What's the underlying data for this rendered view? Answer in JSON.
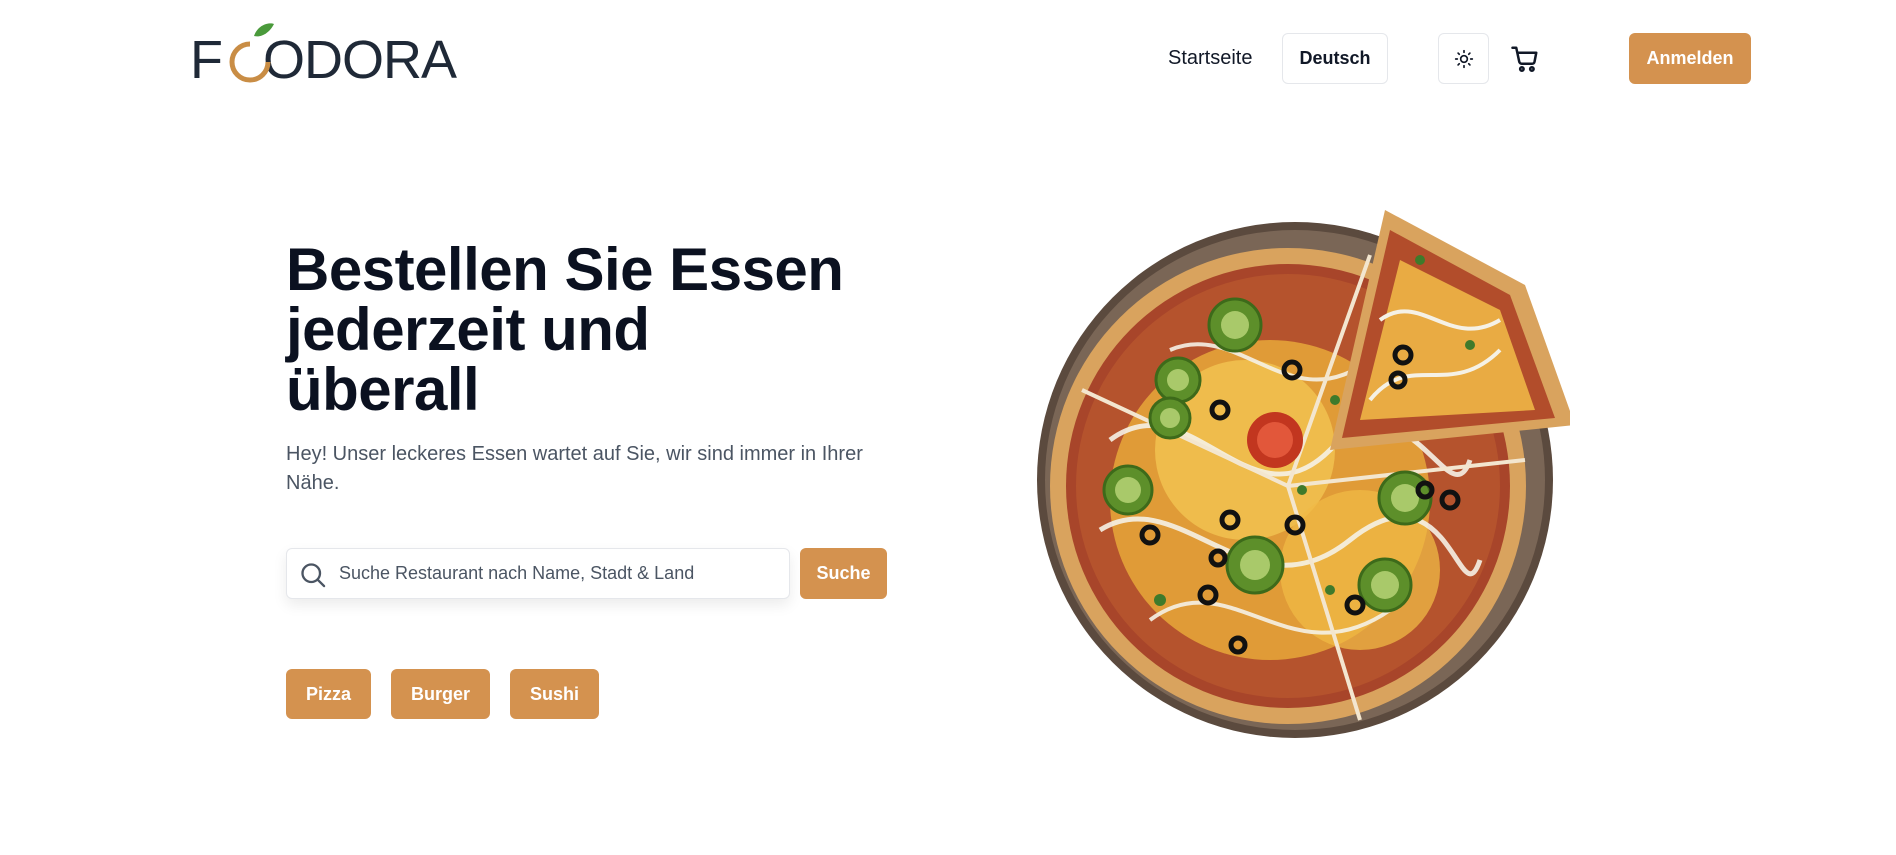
{
  "header": {
    "logo_text": "FOODORA",
    "nav_home": "Startseite",
    "language": "Deutsch",
    "theme_icon": "sun-icon",
    "cart_icon": "cart-icon",
    "login": "Anmelden"
  },
  "hero": {
    "title_line1": "Bestellen Sie Essen",
    "title_line2": "jederzeit und",
    "title_line3": "überall",
    "subtitle": "Hey! Unser leckeres Essen wartet auf Sie, wir sind immer in Ihrer Nähe.",
    "search": {
      "placeholder": "Suche Restaurant nach Name, Stadt & Land",
      "value": "",
      "button": "Suche",
      "icon": "search-icon"
    },
    "categories": [
      "Pizza",
      "Burger",
      "Sushi"
    ]
  },
  "colors": {
    "accent": "#d4924f",
    "heading": "#0b1120",
    "text_muted": "#4b5563",
    "border": "#e5e7eb"
  }
}
